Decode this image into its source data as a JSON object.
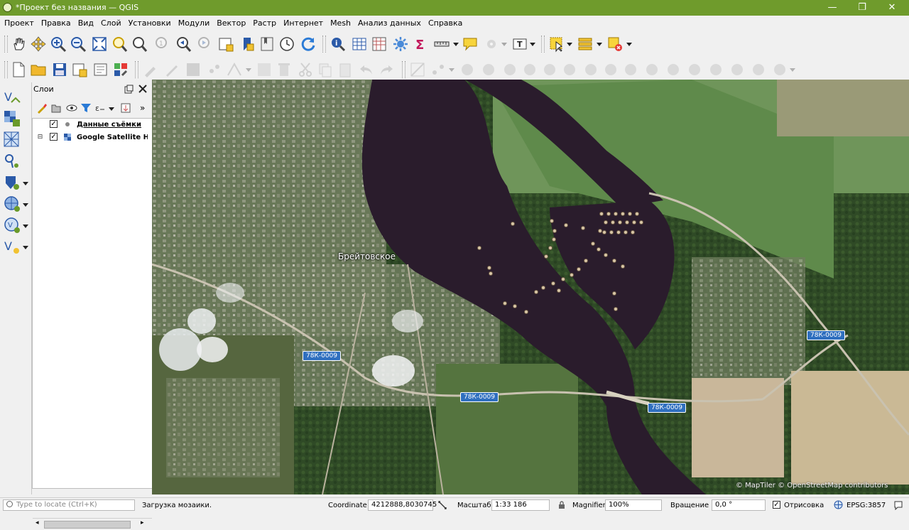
{
  "window": {
    "title": "*Проект без названия — QGIS",
    "minimize": "—",
    "maximize": "❐",
    "close": "✕"
  },
  "menu": [
    "Проект",
    "Правка",
    "Вид",
    "Слой",
    "Установки",
    "Модули",
    "Вектор",
    "Растр",
    "Интернет",
    "Mesh",
    "Анализ данных",
    "Справка"
  ],
  "layers_panel": {
    "title": "Слои",
    "expand_label": "»",
    "layers": [
      {
        "name": "Данные съёмки",
        "checked": true,
        "icon": "point-layer-icon"
      },
      {
        "name": "Google Satellite Hybrid",
        "checked": true,
        "icon": "raster-layer-icon"
      }
    ]
  },
  "map": {
    "place_label": "Брейтовское",
    "road_labels": [
      "78К-0009",
      "78К-0009",
      "78К-0009",
      "78К-0009"
    ],
    "attribution": "© MapTiler © OpenStreetMap contributors"
  },
  "status": {
    "locator_placeholder": "Type to locate (Ctrl+K)",
    "message": "Загрузка мозаики.",
    "coordinate_label": "Coordinate",
    "coordinate_value": "4212888,8030745",
    "scale_label": "Масштаб",
    "scale_value": "1:33 186",
    "magnifier_label": "Magnifier",
    "magnifier_value": "100%",
    "rotation_label": "Вращение",
    "rotation_value": "0,0 °",
    "render_label": "Отрисовка",
    "crs_label": "EPSG:3857"
  },
  "colors": {
    "titlebar": "#6f9b2c",
    "water": "#2a1c2c",
    "road_badge": "#2f6fbf"
  }
}
